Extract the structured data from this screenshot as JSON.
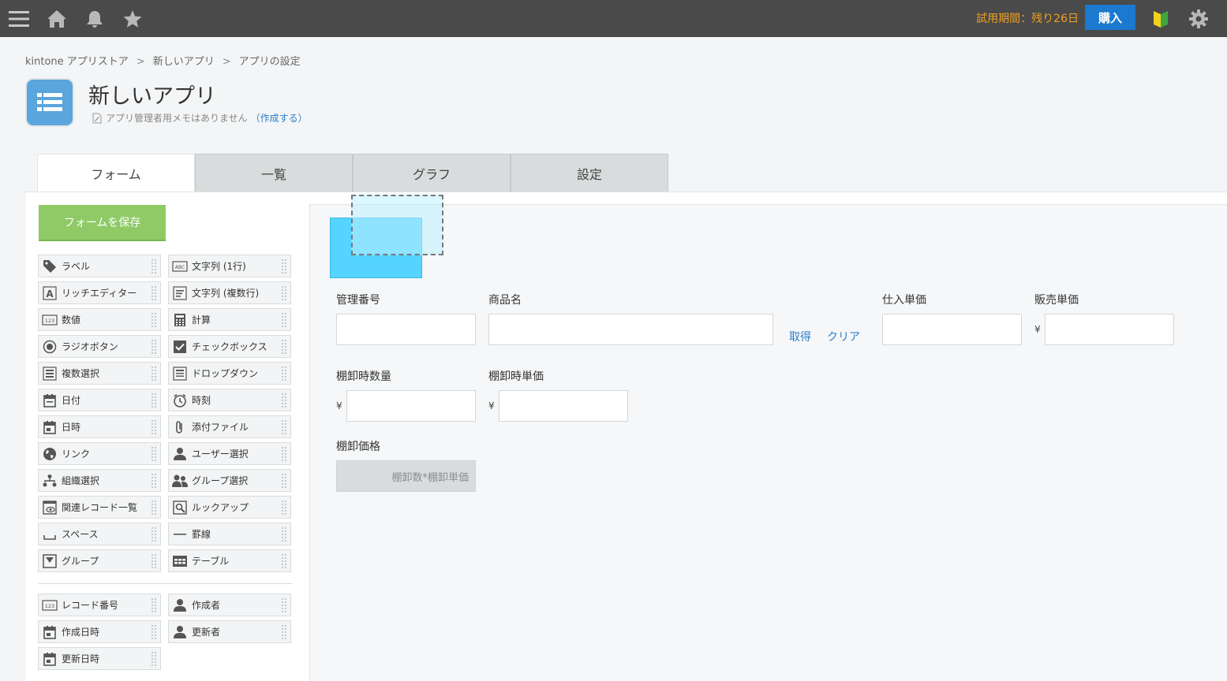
{
  "topbar": {
    "trial_text": "試用期間：残り26日",
    "buy_label": "購入",
    "icons": [
      "menu-icon",
      "home-icon",
      "bell-icon",
      "star-icon",
      "beginner-icon",
      "gear-icon"
    ]
  },
  "breadcrumb": {
    "items": [
      "kintone アプリストア",
      "新しいアプリ",
      "アプリの設定"
    ],
    "separator": ">"
  },
  "app": {
    "title": "新しいアプリ",
    "memo_text": "アプリ管理者用メモはありません",
    "memo_link": "（作成する）"
  },
  "tabs": [
    "フォーム",
    "一覧",
    "グラフ",
    "設定"
  ],
  "sidebar": {
    "save_label": "フォームを保存",
    "palette": [
      {
        "label": "ラベル",
        "icon": "tag-icon"
      },
      {
        "label": "文字列 (1行)",
        "icon": "abc-icon"
      },
      {
        "label": "リッチエディター",
        "icon": "rich-editor-icon"
      },
      {
        "label": "文字列 (複数行)",
        "icon": "multiline-text-icon"
      },
      {
        "label": "数値",
        "icon": "number-icon"
      },
      {
        "label": "計算",
        "icon": "calculator-icon"
      },
      {
        "label": "ラジオボタン",
        "icon": "radio-icon"
      },
      {
        "label": "チェックボックス",
        "icon": "checkbox-icon"
      },
      {
        "label": "複数選択",
        "icon": "multi-select-icon"
      },
      {
        "label": "ドロップダウン",
        "icon": "dropdown-icon"
      },
      {
        "label": "日付",
        "icon": "calendar-icon"
      },
      {
        "label": "時刻",
        "icon": "clock-icon"
      },
      {
        "label": "日時",
        "icon": "datetime-icon"
      },
      {
        "label": "添付ファイル",
        "icon": "paperclip-icon"
      },
      {
        "label": "リンク",
        "icon": "globe-icon"
      },
      {
        "label": "ユーザー選択",
        "icon": "user-icon"
      },
      {
        "label": "組織選択",
        "icon": "org-icon"
      },
      {
        "label": "グループ選択",
        "icon": "group-icon"
      },
      {
        "label": "関連レコード一覧",
        "icon": "related-records-icon"
      },
      {
        "label": "ルックアップ",
        "icon": "lookup-icon"
      },
      {
        "label": "スペース",
        "icon": "space-icon"
      },
      {
        "label": "罫線",
        "icon": "line-icon"
      },
      {
        "label": "グループ",
        "icon": "group-field-icon"
      },
      {
        "label": "テーブル",
        "icon": "table-icon"
      }
    ],
    "system_fields": [
      {
        "label": "レコード番号",
        "icon": "number-icon"
      },
      {
        "label": "作成者",
        "icon": "user-icon"
      },
      {
        "label": "作成日時",
        "icon": "calendar-icon"
      },
      {
        "label": "更新者",
        "icon": "user-icon"
      },
      {
        "label": "更新日時",
        "icon": "calendar-icon"
      }
    ]
  },
  "form": {
    "fields": {
      "kanri_bango": "管理番号",
      "shohin_mei": "商品名",
      "shiire_tanka": "仕入単価",
      "hanbai_tanka": "販売単価",
      "tanaoroshi_suryo": "棚卸時数量",
      "tanaoroshi_tanka": "棚卸時単価",
      "tanaoroshi_kakaku": "棚卸価格"
    },
    "lookup_get": "取得",
    "lookup_clear": "クリア",
    "currency_symbol": "¥",
    "calc_formula": "棚卸数*棚卸単価"
  }
}
